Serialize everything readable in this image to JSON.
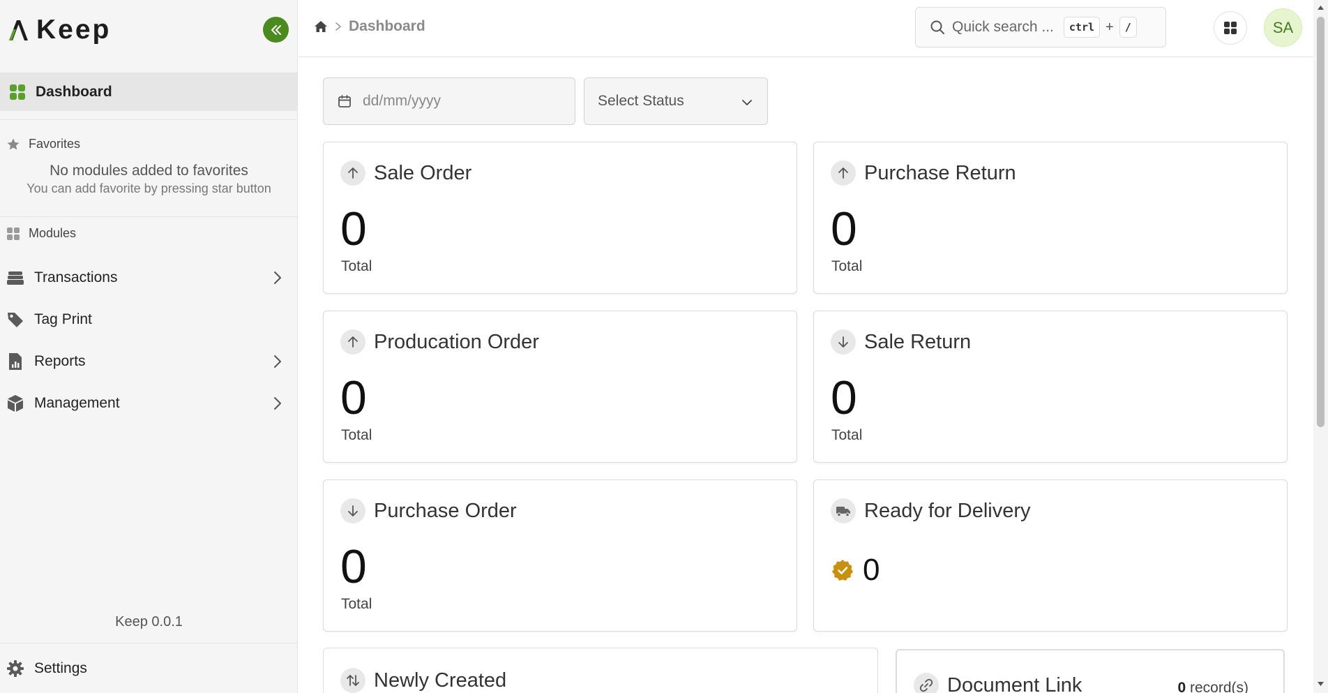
{
  "sidebar": {
    "brand": "Keep",
    "dashboard_label": "Dashboard",
    "favorites_label": "Favorites",
    "favorites_empty_title": "No modules added to favorites",
    "favorites_empty_hint": "You can add favorite by pressing star button",
    "modules_label": "Modules",
    "items": [
      {
        "label": "Transactions",
        "icon": "layers-icon",
        "expandable": true
      },
      {
        "label": "Tag Print",
        "icon": "tag-icon",
        "expandable": false
      },
      {
        "label": "Reports",
        "icon": "report-icon",
        "expandable": true
      },
      {
        "label": "Management",
        "icon": "box-icon",
        "expandable": true
      }
    ],
    "version": "Keep 0.0.1",
    "settings_label": "Settings"
  },
  "header": {
    "breadcrumb_current": "Dashboard",
    "search_placeholder": "Quick search ...",
    "shortcut_key1": "ctrl",
    "shortcut_plus": "+",
    "shortcut_key2": "/",
    "avatar_initials": "SA"
  },
  "filters": {
    "date_placeholder": "dd/mm/yyyy",
    "status_placeholder": "Select Status"
  },
  "cards": [
    {
      "title": "Sale Order",
      "value": "0",
      "sub": "Total",
      "icon": "arrow-up-icon"
    },
    {
      "title": "Purchase Return",
      "value": "0",
      "sub": "Total",
      "icon": "arrow-up-icon"
    },
    {
      "title": "Producation Order",
      "value": "0",
      "sub": "Total",
      "icon": "arrow-up-icon"
    },
    {
      "title": "Sale Return",
      "value": "0",
      "sub": "Total",
      "icon": "arrow-down-icon"
    },
    {
      "title": "Purchase Order",
      "value": "0",
      "sub": "Total",
      "icon": "arrow-down-icon"
    },
    {
      "title": "Ready for Delivery",
      "value": "0",
      "icon": "truck-icon"
    }
  ],
  "bottom": {
    "newly_created_title": "Newly Created",
    "document_link_title": "Document Link",
    "document_count": "0",
    "document_count_suffix": "record(s)"
  },
  "colors": {
    "accent_green": "#4a8a1f",
    "dashboard_icon_green": "#5aa02c",
    "avatar_bg": "#e6f5cf",
    "ready_badge": "#c8900e"
  }
}
